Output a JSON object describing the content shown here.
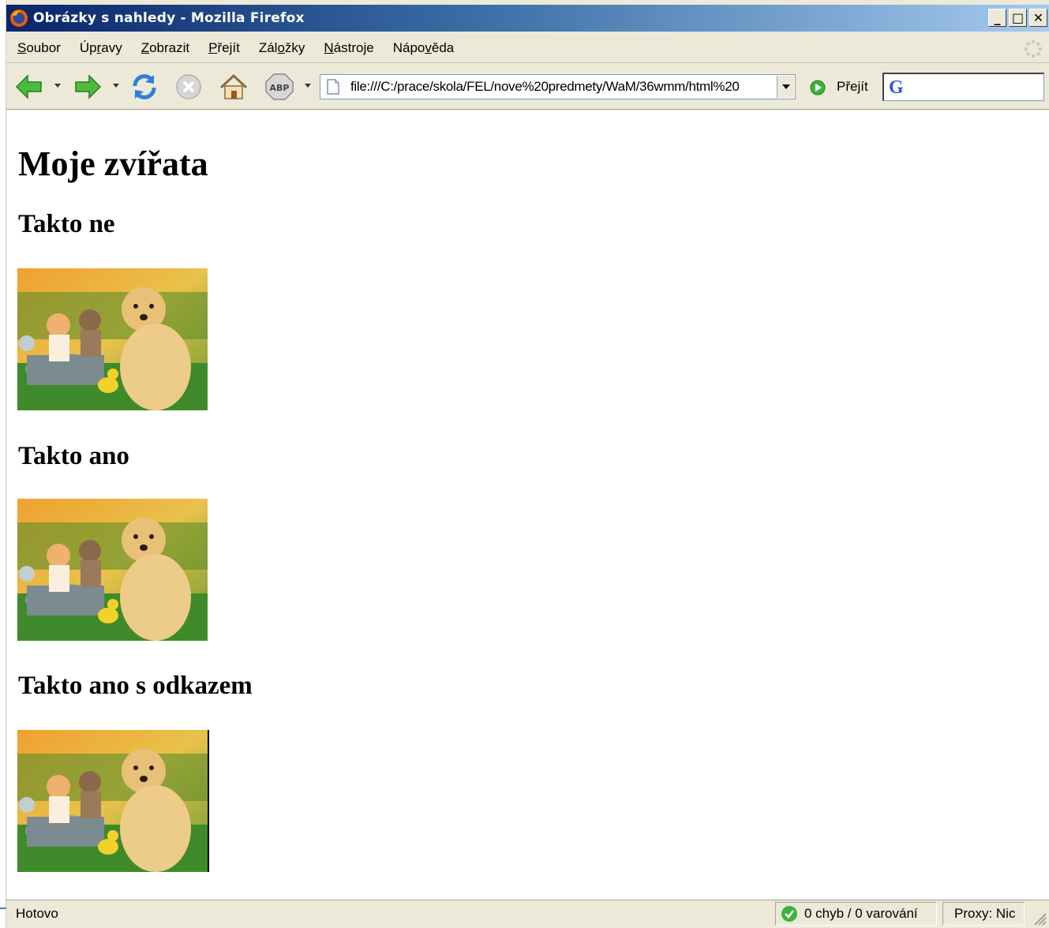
{
  "window": {
    "title": "Obrázky s nahledy - Mozilla Firefox",
    "buttons": {
      "minimize": "_",
      "maximize": "□",
      "close": "✕"
    }
  },
  "menu": [
    {
      "pre": "",
      "u": "S",
      "post": "oubor"
    },
    {
      "pre": "Úp",
      "u": "r",
      "post": "avy"
    },
    {
      "pre": "",
      "u": "Z",
      "post": "obrazit"
    },
    {
      "pre": "",
      "u": "P",
      "post": "řejít"
    },
    {
      "pre": "Zál",
      "u": "o",
      "post": "žky"
    },
    {
      "pre": "",
      "u": "N",
      "post": "ástroje"
    },
    {
      "pre": "Nápo",
      "u": "v",
      "post": "ěda"
    }
  ],
  "toolbar": {
    "url": "file:///C:/prace/skola/FEL/nove%20predmety/WaM/36wmm/html%20",
    "go_label": "Přejít",
    "adblock_label": "ABP",
    "search_value": ""
  },
  "page": {
    "heading": "Moje zvířata",
    "sections": [
      {
        "heading": "Takto ne"
      },
      {
        "heading": "Takto ano"
      },
      {
        "heading": "Takto ano s odkazem"
      }
    ]
  },
  "status": {
    "text": "Hotovo",
    "validator": "0 chyb / 0 varování",
    "proxy": "Proxy: Nic"
  },
  "colors": {
    "titlebar_start": "#0a246a",
    "titlebar_end": "#a6caf0",
    "chrome": "#ece9d8",
    "arrow_green": "#4cbb3c"
  }
}
